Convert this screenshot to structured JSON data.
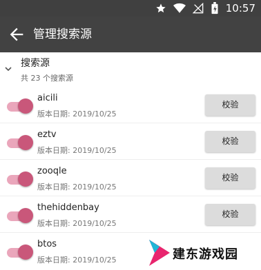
{
  "status_bar": {
    "time": "10:57",
    "icons": [
      "star-icon",
      "wifi-icon",
      "no-signal-icon",
      "battery-icon"
    ]
  },
  "app_bar": {
    "back_icon": "back-arrow-icon",
    "title": "管理搜索源"
  },
  "group": {
    "title": "搜索源",
    "subtitle": "共 23 个搜索源",
    "expanded": true
  },
  "verify_label": "校验",
  "sources": [
    {
      "name": "aicili",
      "date": "版本日期: 2019/10/25",
      "enabled": true
    },
    {
      "name": "eztv",
      "date": "版本日期: 2019/10/25",
      "enabled": true
    },
    {
      "name": "zooqle",
      "date": "版本日期: 2019/10/25",
      "enabled": true
    },
    {
      "name": "thehiddenbay",
      "date": "版本日期: 2019/10/25",
      "enabled": true
    },
    {
      "name": "btos",
      "date": "版本日期: 2019/10/25",
      "enabled": true
    }
  ],
  "watermark": {
    "text": "建东游戏园"
  },
  "colors": {
    "app_bar": "#424242",
    "status_bar": "#404040",
    "toggle_thumb": "#c9577a",
    "toggle_track": "#eaa6bb",
    "button_bg": "#dcdcdc"
  }
}
